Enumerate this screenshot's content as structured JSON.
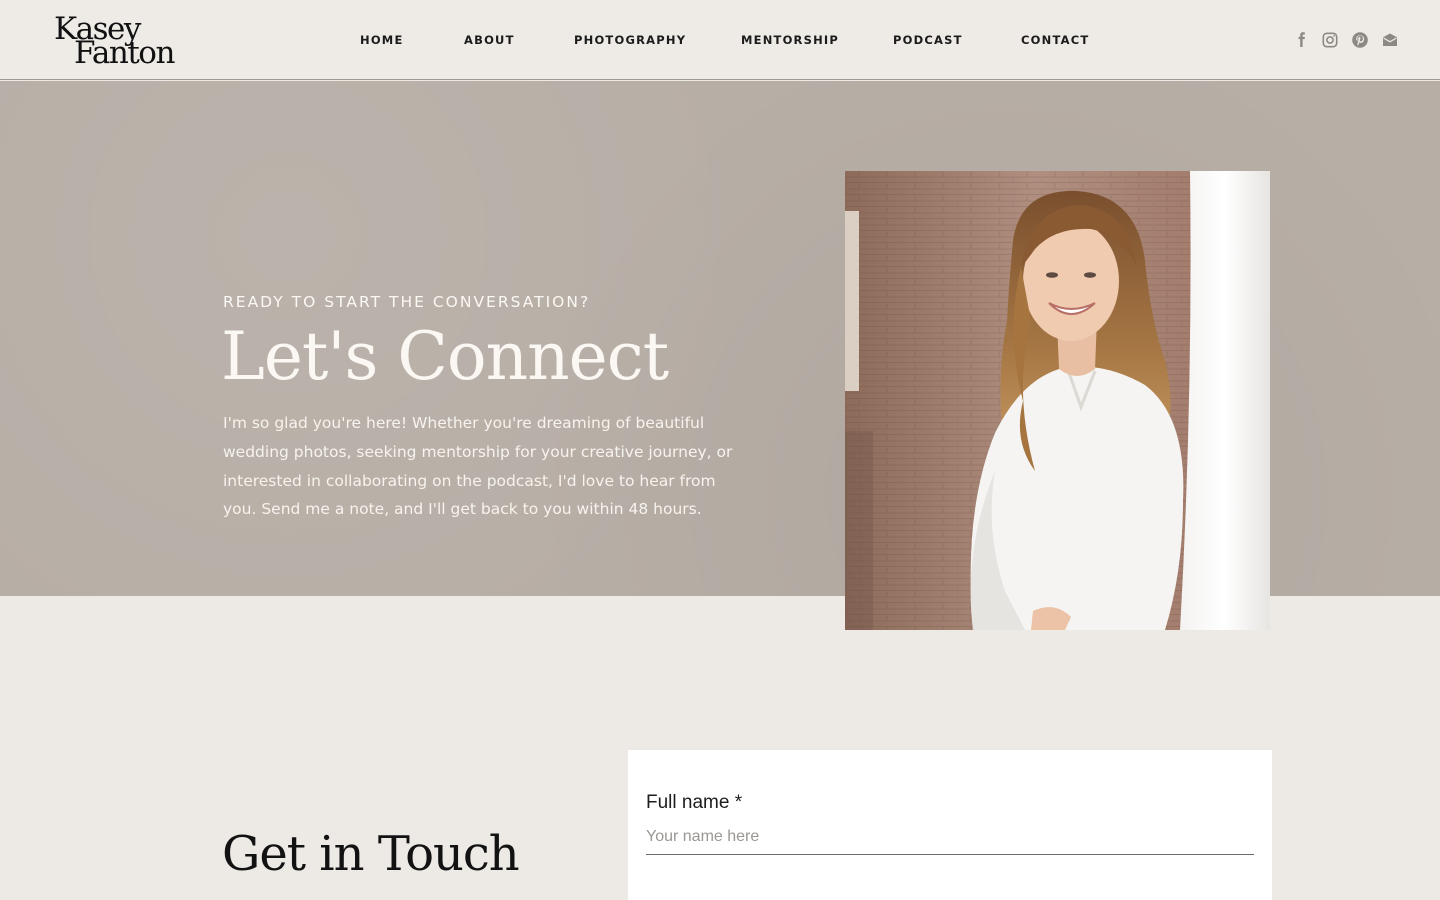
{
  "brand": {
    "logo_line1": "Kasey",
    "logo_line2": "Fanton"
  },
  "nav": {
    "items": [
      {
        "label": "HOME"
      },
      {
        "label": "ABOUT"
      },
      {
        "label": "PHOTOGRAPHY"
      },
      {
        "label": "MENTORSHIP"
      },
      {
        "label": "PODCAST"
      },
      {
        "label": "CONTACT"
      }
    ]
  },
  "social": {
    "icons": [
      "facebook-icon",
      "instagram-icon",
      "pinterest-icon",
      "email-icon"
    ],
    "icon_color": "#8d8884"
  },
  "hero": {
    "eyebrow": "READY TO START THE CONVERSATION?",
    "title": "Let's Connect",
    "body": "I'm so glad you're here! Whether you're dreaming of beautiful wedding photos, seeking mentorship for your creative journey, or interested in collaborating on the podcast, I'd love to hear from you. Send me a note, and I'll get back to you within 48 hours.",
    "background_color": "#b7aea6"
  },
  "contact": {
    "section_title": "Get in Touch",
    "form": {
      "full_name_label": "Full name *",
      "full_name_placeholder": "Your name here",
      "full_name_value": ""
    }
  },
  "colors": {
    "page_background": "#ede9e5",
    "header_background": "#eeebe7",
    "hero_text": "#fbf8f4",
    "heading_dark": "#121212"
  }
}
